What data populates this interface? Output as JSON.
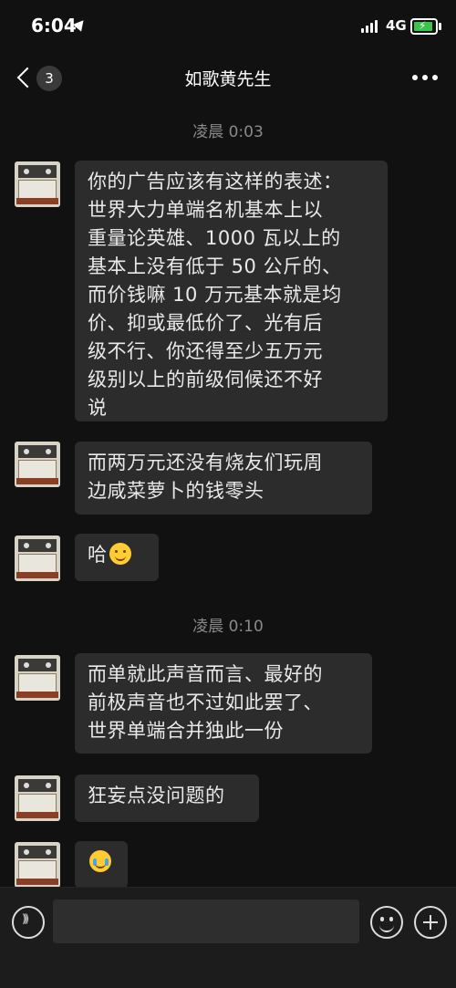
{
  "status": {
    "time": "6:04",
    "network": "4G"
  },
  "nav": {
    "badge_count": "3",
    "title": "如歌黄先生"
  },
  "timestamps": [
    "凌晨 0:03",
    "凌晨 0:10"
  ],
  "messages": [
    {
      "lines": [
        "你的广告应该有这样的表述：",
        "世界大力单端名机基本上以",
        "重量论英雄、1000 瓦以上的",
        "基本上没有低于 50 公斤的、",
        "而价钱嘛 10 万元基本就是均",
        "价、抑或最低价了、光有后",
        "级不行、你还得至少五万元",
        "级别以上的前级伺候还不好",
        "说"
      ]
    },
    {
      "lines": [
        "而两万元还没有烧友们玩周",
        "边咸菜萝卜的钱零头"
      ]
    },
    {
      "text": "哈",
      "emoji": "smile-emoji"
    },
    {
      "lines": [
        "而单就此声音而言、最好的",
        "前极声音也不过如此罢了、",
        "世界单端合并独此一份"
      ]
    },
    {
      "lines": [
        "狂妄点没问题的"
      ]
    },
    {
      "emoji": "cry-laugh-emoji"
    }
  ]
}
